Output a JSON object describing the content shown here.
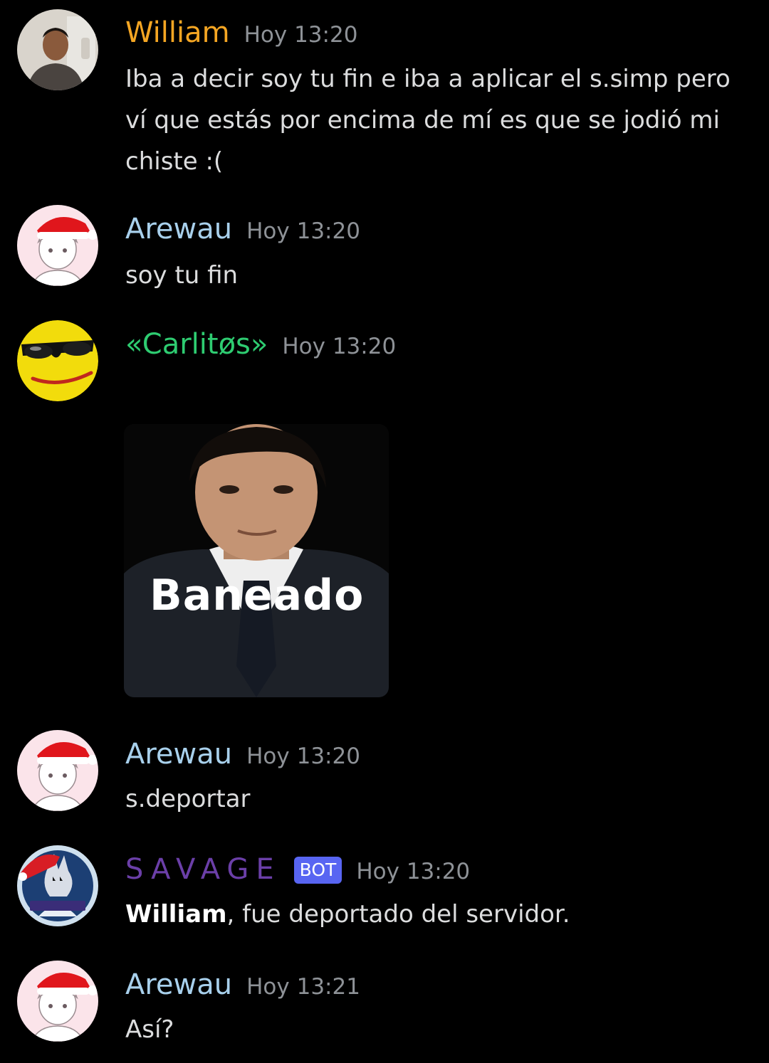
{
  "messages": [
    {
      "author": "William",
      "author_color": "#f5a623",
      "timestamp": "Hoy 13:20",
      "text": "Iba a decir soy tu fin e iba a aplicar el s.simp pero ví que estás por encima de mí es que se jodió mi chiste :("
    },
    {
      "author": "Arewau",
      "author_color": "#a8d0ec",
      "timestamp": "Hoy 13:20",
      "text": "soy tu fin"
    },
    {
      "author": "«Carlitøs»",
      "author_color": "#2ecc71",
      "timestamp": "Hoy 13:20",
      "image_caption": "Baneado"
    },
    {
      "author": "Arewau",
      "author_color": "#a8d0ec",
      "timestamp": "Hoy 13:20",
      "text": "s.deportar"
    },
    {
      "author": "SAVAGE",
      "author_color": "#6b3fa8",
      "bot_tag": "BOT",
      "timestamp": "Hoy 13:20",
      "mention": "William",
      "text": ", fue deportado del servidor."
    },
    {
      "author": "Arewau",
      "author_color": "#a8d0ec",
      "timestamp": "Hoy 13:21",
      "text": "Así?"
    }
  ],
  "avatars": {
    "william": "photo-avatar",
    "arewau": "anime-santa-hat-avatar",
    "carlitos": "sunglasses-emoji-avatar",
    "savage": "wolf-logo-avatar"
  }
}
